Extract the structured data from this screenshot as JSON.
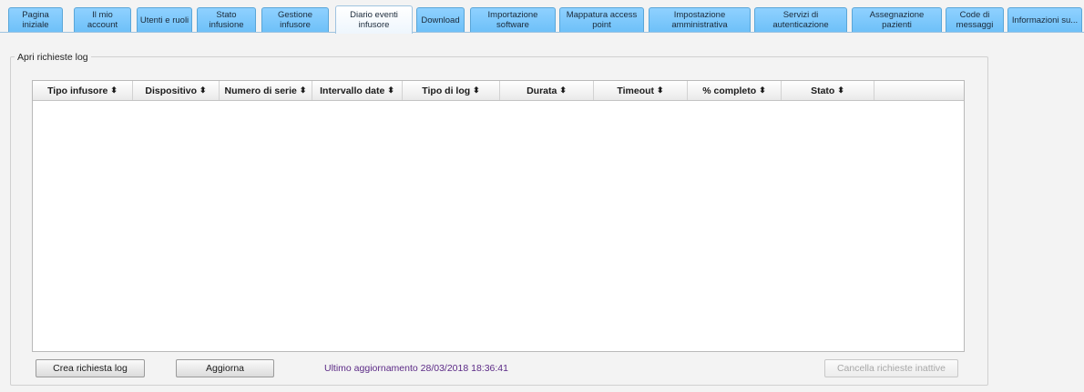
{
  "tabs": [
    {
      "label": "Pagina iniziale",
      "active": false
    },
    {
      "label": "Il mio account",
      "active": false
    },
    {
      "label": "Utenti e ruoli",
      "active": false
    },
    {
      "label": "Stato infusione",
      "active": false
    },
    {
      "label": "Gestione infusore",
      "active": false
    },
    {
      "label": "Diario eventi infusore",
      "active": true
    },
    {
      "label": "Download",
      "active": false
    },
    {
      "label": "Importazione software",
      "active": false
    },
    {
      "label": "Mappatura access point",
      "active": false
    },
    {
      "label": "Impostazione amministrativa",
      "active": false
    },
    {
      "label": "Servizi di autenticazione",
      "active": false
    },
    {
      "label": "Assegnazione pazienti",
      "active": false
    },
    {
      "label": "Code di messaggi",
      "active": false
    },
    {
      "label": "Informazioni su...",
      "active": false
    }
  ],
  "group": {
    "title": "Apri richieste log"
  },
  "table": {
    "columns": [
      {
        "label": "Tipo infusore",
        "sort_icon": "sort-icon"
      },
      {
        "label": "Dispositivo",
        "sort_icon": "sort-icon"
      },
      {
        "label": "Numero di serie",
        "sort_icon": "sort-icon"
      },
      {
        "label": "Intervallo date",
        "sort_icon": "sort-icon"
      },
      {
        "label": "Tipo di log",
        "sort_icon": "sort-icon"
      },
      {
        "label": "Durata",
        "sort_icon": "sort-icon"
      },
      {
        "label": "Timeout",
        "sort_icon": "sort-icon"
      },
      {
        "label": "% completo",
        "sort_icon": "sort-icon"
      },
      {
        "label": "Stato",
        "sort_icon": "sort-icon"
      }
    ],
    "rows": []
  },
  "footer": {
    "create_label": "Crea richiesta log",
    "refresh_label": "Aggiorna",
    "last_update": "Ultimo aggiornamento 28/03/2018 18:36:41",
    "clear_label": "Cancella richieste inattive"
  },
  "colors": {
    "tab": "#7ec8fc",
    "active_tab": "#ffffff",
    "status_text": "#5b2a86"
  }
}
